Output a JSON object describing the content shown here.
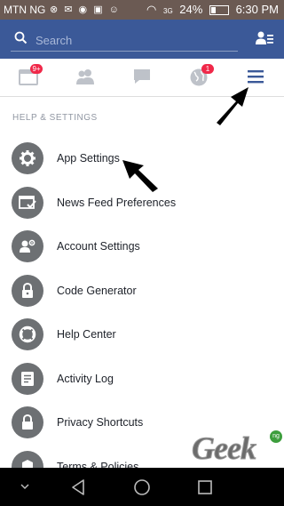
{
  "status_bar": {
    "carrier": "MTN NG",
    "network_type": "3G",
    "battery": "24%",
    "time": "6:30 PM"
  },
  "search": {
    "placeholder": "Search"
  },
  "tabs": [
    {
      "icon": "news-feed-icon",
      "badge": "9+"
    },
    {
      "icon": "friend-requests-icon",
      "badge": ""
    },
    {
      "icon": "messages-icon",
      "badge": ""
    },
    {
      "icon": "notifications-globe-icon",
      "badge": "1"
    },
    {
      "icon": "menu-icon",
      "badge": ""
    }
  ],
  "section_header": "HELP & SETTINGS",
  "menu_items": [
    {
      "label": "App Settings",
      "icon": "gear-icon"
    },
    {
      "label": "News Feed Preferences",
      "icon": "news-feed-preferences-icon"
    },
    {
      "label": "Account Settings",
      "icon": "account-settings-icon"
    },
    {
      "label": "Code Generator",
      "icon": "lock-icon"
    },
    {
      "label": "Help Center",
      "icon": "lifebuoy-icon"
    },
    {
      "label": "Activity Log",
      "icon": "activity-log-icon"
    },
    {
      "label": "Privacy Shortcuts",
      "icon": "lock-icon"
    },
    {
      "label": "Terms & Policies",
      "icon": "terms-icon"
    }
  ],
  "watermark": {
    "text": "Geek",
    "badge": "ng"
  },
  "colors": {
    "facebook_blue": "#3b5998",
    "status_bar": "#6b5a53",
    "badge_red": "#f02849",
    "icon_gray": "#6d7073"
  }
}
